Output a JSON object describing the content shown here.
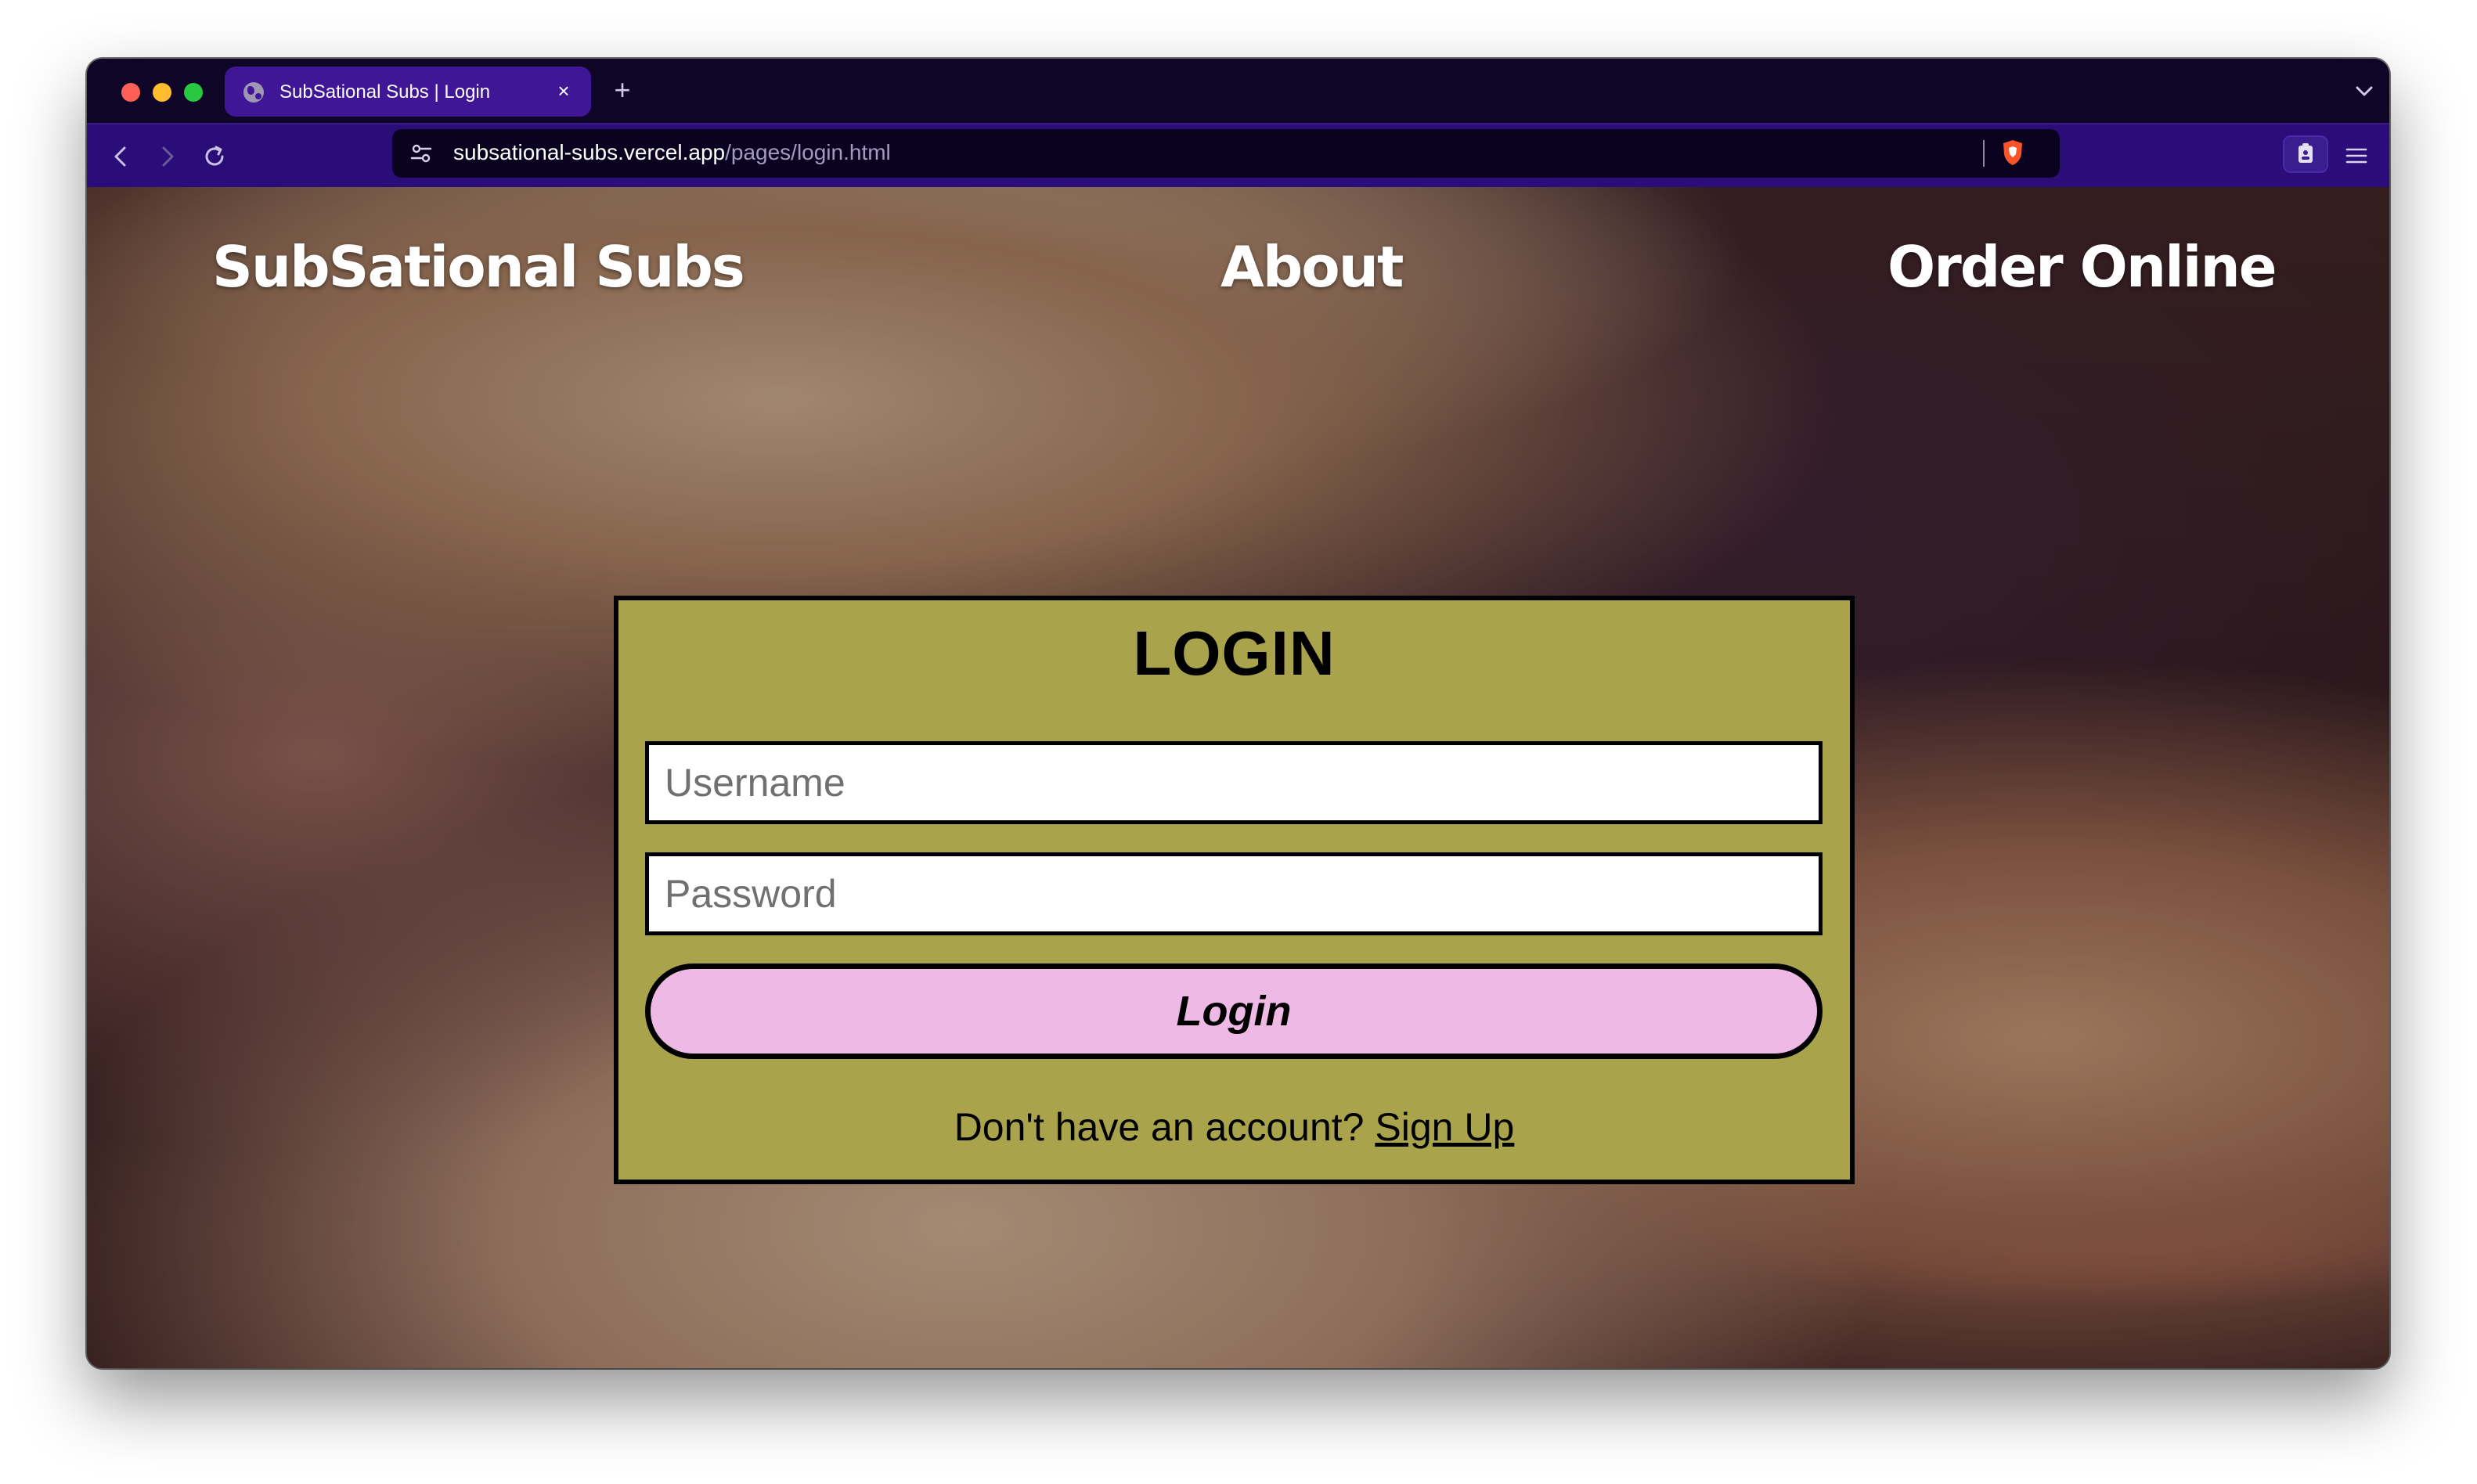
{
  "browser": {
    "tab_title": "SubSational Subs | Login",
    "tab_close": "×",
    "new_tab": "+",
    "url_host": "subsational-subs.vercel.app",
    "url_path": "/pages/login.html",
    "icons": [
      "globe-icon",
      "back-icon",
      "forward-icon",
      "reload-icon",
      "site-settings-icon",
      "brave-shield-icon",
      "extension-icon",
      "menu-icon",
      "chevron-down-icon"
    ]
  },
  "nav": {
    "brand": "SubSational Subs",
    "about": "About",
    "order": "Order Online"
  },
  "login": {
    "title": "LOGIN",
    "username_placeholder": "Username",
    "password_placeholder": "Password",
    "button_label": "Login",
    "signup_prompt": "Don't have an account?",
    "signup_link": "Sign Up"
  },
  "colors": {
    "card_background": "#a9a34c",
    "button_background": "#efb9e6",
    "toolbar": "#2a0d78",
    "tab_active": "#3f1796"
  }
}
